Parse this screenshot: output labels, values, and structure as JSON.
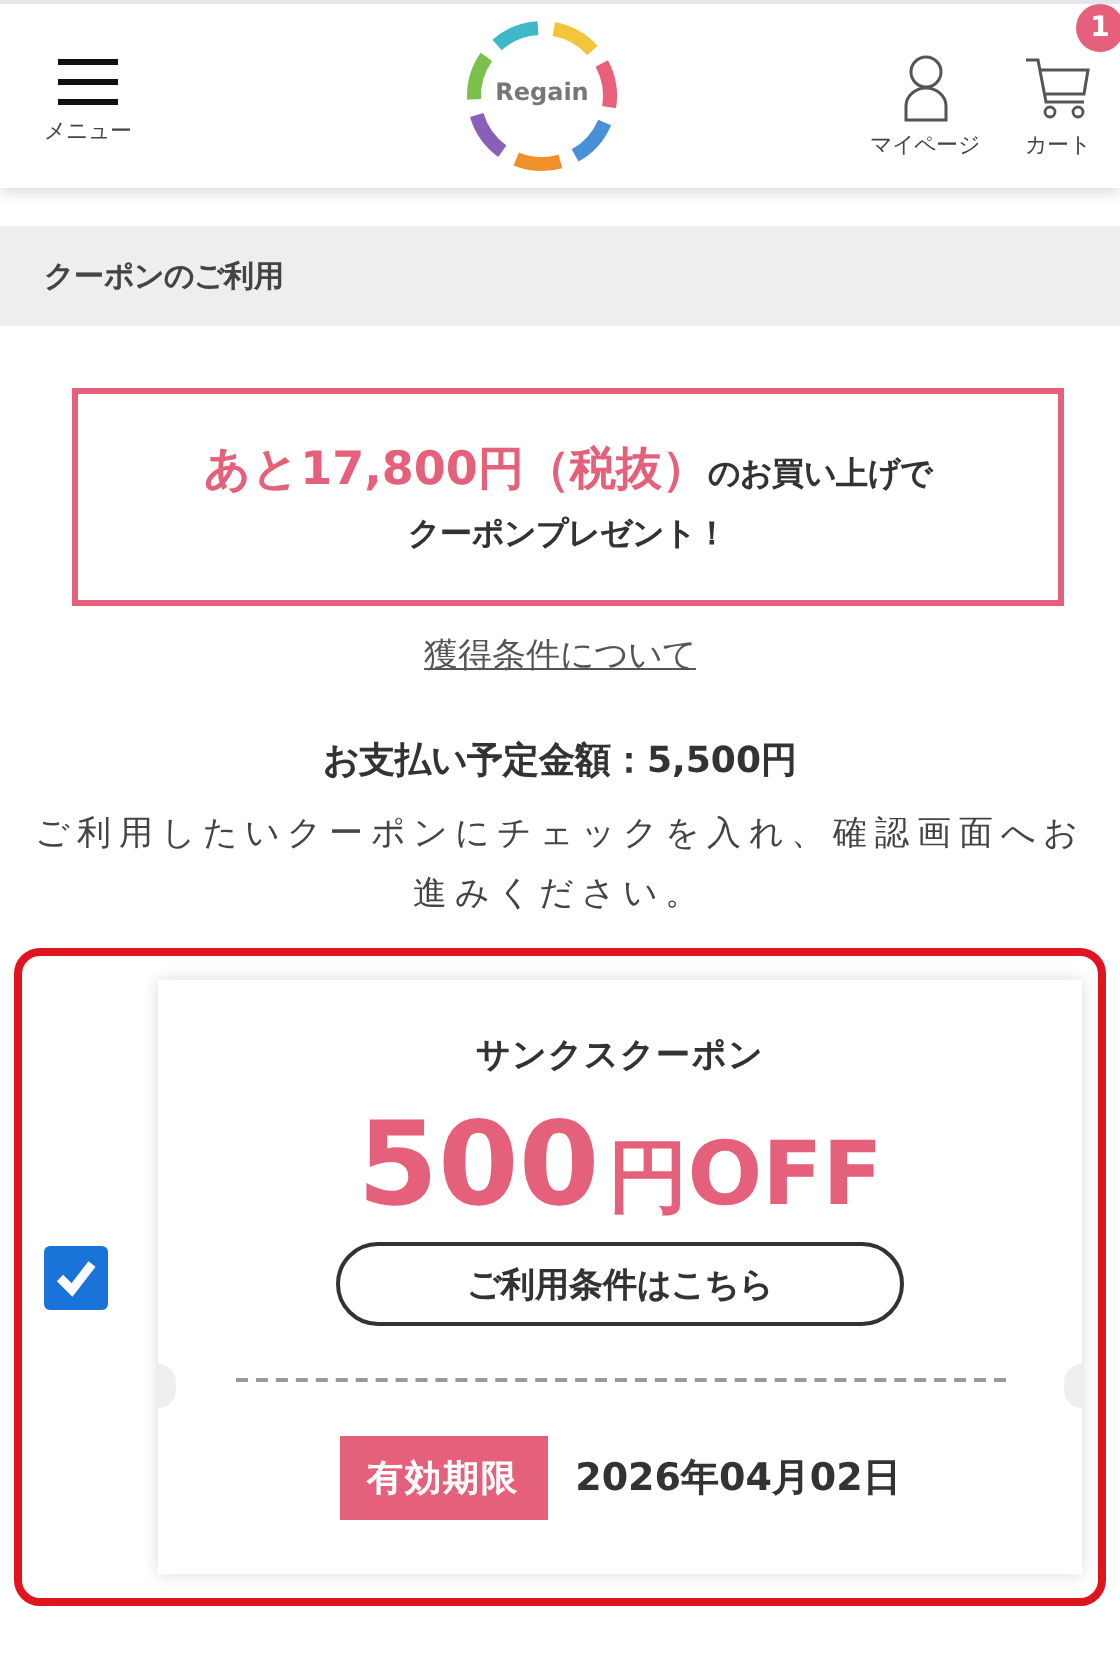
{
  "header": {
    "menu_label": "メニュー",
    "logo_text": "Regain",
    "mypage_label": "マイページ",
    "cart_label": "カート",
    "cart_count": "1"
  },
  "section_title": "クーポンのご利用",
  "promo": {
    "amount": "あと17,800円（税抜）",
    "text": "のお買い上げで",
    "line2": "クーポンプレゼント！"
  },
  "conditions_link": "獲得条件について",
  "total": "お支払い予定金額：5,500円",
  "instruction": "ご利用したいクーポンにチェックを入れ、確認画面へお進みください。",
  "coupons": [
    {
      "checked": true,
      "name": "サンクスクーポン",
      "amount": "500",
      "unit": "円",
      "off": "OFF",
      "terms_button": "ご利用条件はこちら",
      "expiry_label": "有効期限",
      "expiry_date": "2026年04月02日"
    }
  ]
}
